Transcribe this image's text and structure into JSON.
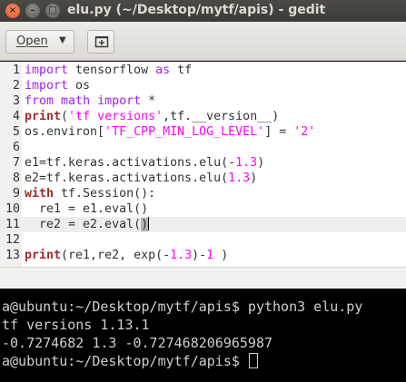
{
  "window": {
    "title": "elu.py (~/Desktop/mytf/apis) - gedit",
    "close_glyph": "×",
    "minimize_glyph": "–",
    "maximize_glyph": "□"
  },
  "toolbar": {
    "open_label": "Open",
    "open_arrow": "▼",
    "new_tab_icon": "new-tab-icon"
  },
  "editor": {
    "current_line": 11,
    "lines": [
      {
        "n": "1",
        "tokens": [
          [
            "kw",
            "import"
          ],
          [
            "pl",
            " tensorflow "
          ],
          [
            "kw",
            "as"
          ],
          [
            "pl",
            " tf"
          ]
        ]
      },
      {
        "n": "2",
        "tokens": [
          [
            "kw",
            "import"
          ],
          [
            "pl",
            " os"
          ]
        ]
      },
      {
        "n": "3",
        "tokens": [
          [
            "kw",
            "from"
          ],
          [
            "pl",
            " "
          ],
          [
            "kw",
            "math"
          ],
          [
            "pl",
            " "
          ],
          [
            "kw",
            "import"
          ],
          [
            "pl",
            " *"
          ]
        ]
      },
      {
        "n": "4",
        "tokens": [
          [
            "bi",
            "print"
          ],
          [
            "pl",
            "("
          ],
          [
            "st",
            "'tf versions'"
          ],
          [
            "pl",
            ",tf.__version__)"
          ]
        ]
      },
      {
        "n": "5",
        "tokens": [
          [
            "pl",
            "os.environ["
          ],
          [
            "st",
            "'TF_CPP_MIN_LOG_LEVEL'"
          ],
          [
            "pl",
            "] = "
          ],
          [
            "st",
            "'2'"
          ]
        ]
      },
      {
        "n": "6",
        "tokens": []
      },
      {
        "n": "7",
        "tokens": [
          [
            "pl",
            "e1=tf.keras.activations.elu(-"
          ],
          [
            "nm",
            "1.3"
          ],
          [
            "pl",
            ")"
          ]
        ]
      },
      {
        "n": "8",
        "tokens": [
          [
            "pl",
            "e2=tf.keras.activations.elu("
          ],
          [
            "nm",
            "1.3"
          ],
          [
            "pl",
            ")"
          ]
        ]
      },
      {
        "n": "9",
        "tokens": [
          [
            "bi",
            "with"
          ],
          [
            "pl",
            " tf.Session():"
          ]
        ]
      },
      {
        "n": "10",
        "tokens": [
          [
            "pl",
            "  re1 = e1.eval()"
          ]
        ]
      },
      {
        "n": "11",
        "tokens": [
          [
            "pl",
            "  re2 = e2.eval("
          ],
          [
            "hl",
            ")"
          ],
          [
            "cursor",
            ""
          ]
        ]
      },
      {
        "n": "12",
        "tokens": []
      },
      {
        "n": "13",
        "tokens": [
          [
            "bi",
            "print"
          ],
          [
            "pl",
            "(re1,re2, exp(-"
          ],
          [
            "nm",
            "1.3"
          ],
          [
            "pl",
            ")-"
          ],
          [
            "nm",
            "1"
          ],
          [
            "pl",
            " )"
          ]
        ]
      }
    ]
  },
  "terminal": {
    "lines": [
      "a@ubuntu:~/Desktop/mytf/apis$ python3 elu.py",
      "tf versions 1.13.1",
      "-0.7274682 1.3 -0.727468206965987",
      "a@ubuntu:~/Desktop/mytf/apis$ "
    ]
  }
}
